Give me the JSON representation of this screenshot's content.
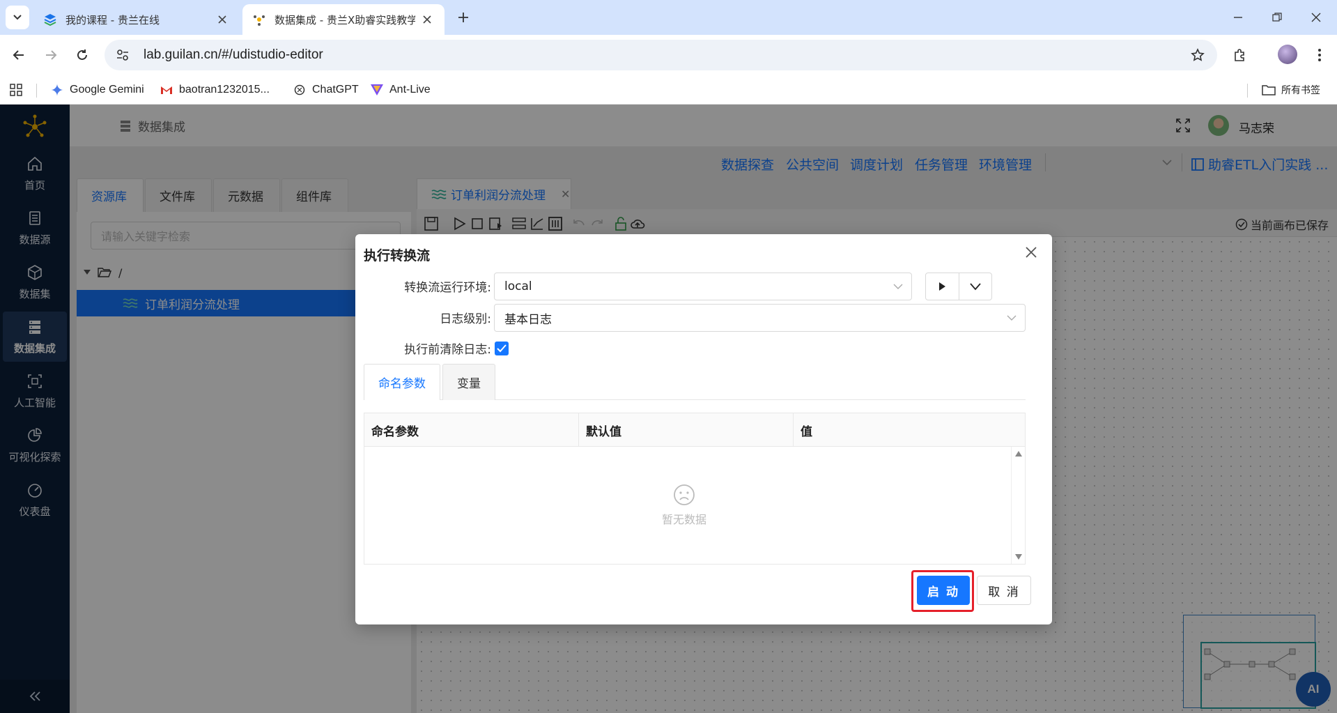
{
  "browser": {
    "tabs": [
      {
        "title": "我的课程 - 贵兰在线"
      },
      {
        "title": "数据集成 - 贵兰X助睿实践教学"
      }
    ],
    "url": "lab.guilan.cn/#/udistudio-editor",
    "bookmarks": [
      {
        "label": "Google Gemini",
        "icon": "gemini-icon"
      },
      {
        "label": "baotran1232015...",
        "icon": "gmail-icon"
      },
      {
        "label": "ChatGPT",
        "icon": "chatgpt-icon"
      },
      {
        "label": "Ant-Live",
        "icon": "antlive-icon"
      }
    ],
    "all_bookmarks": "所有书签"
  },
  "sidebar": {
    "items": [
      {
        "label": "首页",
        "icon": "home-icon"
      },
      {
        "label": "数据源",
        "icon": "datasource-icon"
      },
      {
        "label": "数据集",
        "icon": "cube-icon"
      },
      {
        "label": "数据集成",
        "icon": "database-icon"
      },
      {
        "label": "人工智能",
        "icon": "ai-icon"
      },
      {
        "label": "可视化探索",
        "icon": "pie-icon"
      },
      {
        "label": "仪表盘",
        "icon": "gauge-icon"
      }
    ],
    "active_index": 3
  },
  "header": {
    "title": "数据集成",
    "user": "马志荣"
  },
  "topnav": {
    "items": [
      "数据探查",
      "公共空间",
      "调度计划",
      "任务管理",
      "环境管理"
    ],
    "project": "助睿ETL入门实践 ..."
  },
  "left_panel": {
    "tabs": [
      "资源库",
      "文件库",
      "元数据",
      "组件库"
    ],
    "search_placeholder": "请输入关键字检索",
    "root": "/",
    "item": "订单利润分流处理"
  },
  "canvas": {
    "tab_title": "订单利润分流处理",
    "saved_status": "当前画布已保存"
  },
  "dialog": {
    "title": "执行转换流",
    "env_label": "转换流运行环境:",
    "env_value": "local",
    "log_label": "日志级别:",
    "log_value": "基本日志",
    "clear_label": "执行前清除日志:",
    "clear_checked": true,
    "tabs": [
      "命名参数",
      "变量"
    ],
    "columns": [
      "命名参数",
      "默认值",
      "值"
    ],
    "empty": "暂无数据",
    "start": "启 动",
    "cancel": "取 消"
  },
  "ai_button": "AI",
  "colors": {
    "primary": "#1677ff",
    "sidebar": "#0c1f3a",
    "highlight": "#e5202a"
  }
}
